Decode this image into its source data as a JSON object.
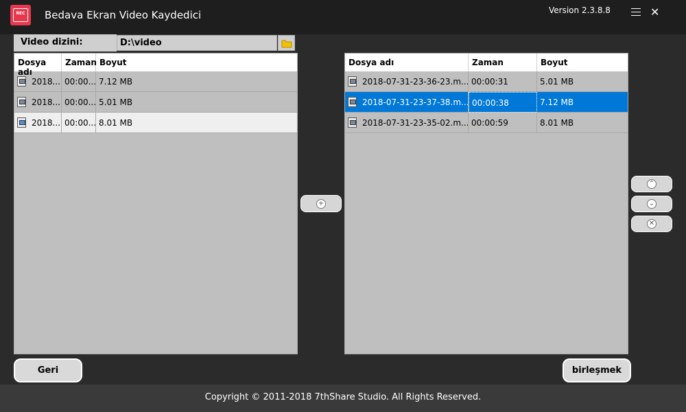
{
  "app": {
    "logo_text": "REC",
    "title": "Bedava Ekran Video Kaydedici",
    "version": "Version 2.3.8.8"
  },
  "directory": {
    "label": "Video dizini:",
    "value": "D:\\video"
  },
  "left_table": {
    "headers": [
      "Dosya adı",
      "Zaman",
      "Boyut"
    ],
    "rows": [
      {
        "name": "2018...",
        "time": "00:00...",
        "size": "7.12 MB"
      },
      {
        "name": "2018...",
        "time": "00:00...",
        "size": "5.01 MB"
      },
      {
        "name": "2018...",
        "time": "00:00...",
        "size": "8.01 MB"
      }
    ]
  },
  "right_table": {
    "headers": [
      "Dosya adı",
      "Zaman",
      "Boyut"
    ],
    "rows": [
      {
        "name": "2018-07-31-23-36-23.m...",
        "time": "00:00:31",
        "size": "5.01 MB"
      },
      {
        "name": "2018-07-31-23-37-38.m...",
        "time": "00:00:38",
        "size": "7.12 MB"
      },
      {
        "name": "2018-07-31-23-35-02.m...",
        "time": "00:00:59",
        "size": "8.01 MB"
      }
    ],
    "selected_index": 1
  },
  "buttons": {
    "add_glyph": "+",
    "up_glyph": "⌃",
    "down_glyph": "⌄",
    "delete_glyph": "✕",
    "back": "Geri",
    "merge": "birleşmek"
  },
  "footer": {
    "copyright": "Copyright © 2011-2018 7thShare Studio. All Rights Reserved."
  },
  "colors": {
    "accent": "#0078d7",
    "logo": "#e8384e",
    "background": "#2b2b2b"
  }
}
